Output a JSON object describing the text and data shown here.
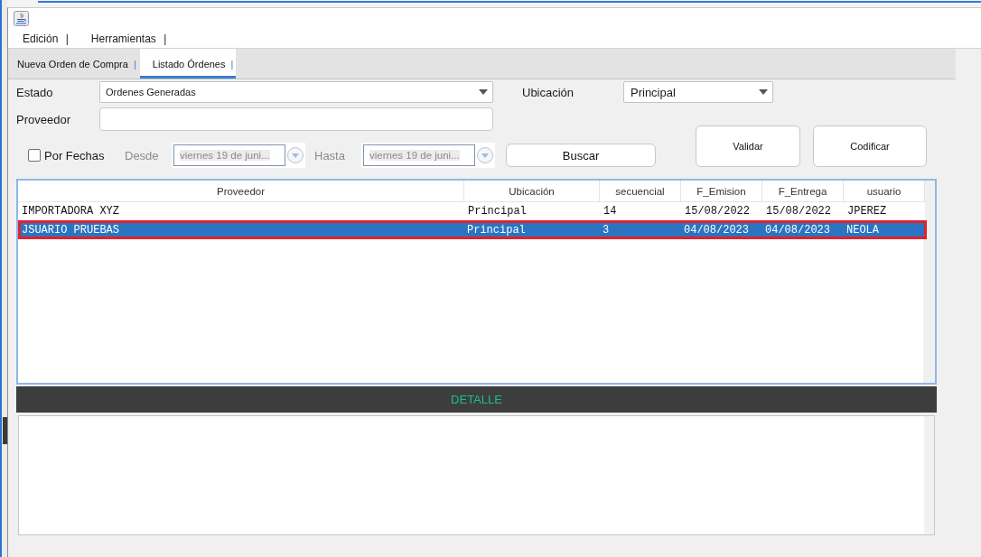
{
  "menu": [
    {
      "label": "Edición",
      "separator": "|"
    },
    {
      "label": "Herramientas",
      "separator": "|"
    }
  ],
  "tabs": [
    {
      "label": "Nueva Orden de Compra",
      "separator": "|",
      "selected": false
    },
    {
      "label": "Listado Órdenes",
      "separator": "|",
      "selected": true
    }
  ],
  "filters": {
    "estado": {
      "label": "Estado",
      "value": "Ordenes Generadas"
    },
    "ubicacion": {
      "label": "Ubicación",
      "value": "Principal"
    },
    "proveedor": {
      "label": "Proveedor"
    },
    "por_fechas": {
      "label": "Por Fechas",
      "checked": false
    },
    "desde": {
      "label": "Desde",
      "value": "viernes 19 de juni...",
      "disabled": true
    },
    "hasta": {
      "label": "Hasta",
      "value": "viernes 19 de juni...",
      "disabled": true
    }
  },
  "buttons": {
    "buscar": {
      "label": "Buscar"
    },
    "validar": {
      "label": "Validar"
    },
    "codificar": {
      "label": "Codificar"
    }
  },
  "table": {
    "columns": [
      "Proveedor",
      "Ubicación",
      "secuencial",
      "F_Emision",
      "F_Entrega",
      "usuario"
    ],
    "rows": [
      {
        "cells": [
          "IMPORTADORA XYZ",
          "Principal",
          "14",
          "15/08/2022",
          "15/08/2022",
          "JPEREZ"
        ],
        "selected": false,
        "outlined": false
      },
      {
        "cells": [
          "JSUARIO PRUEBAS",
          "Principal",
          "3",
          "04/08/2023",
          "04/08/2023",
          "NEOLA"
        ],
        "selected": true,
        "outlined": true
      }
    ]
  },
  "detail": {
    "title": "DETALLE"
  }
}
